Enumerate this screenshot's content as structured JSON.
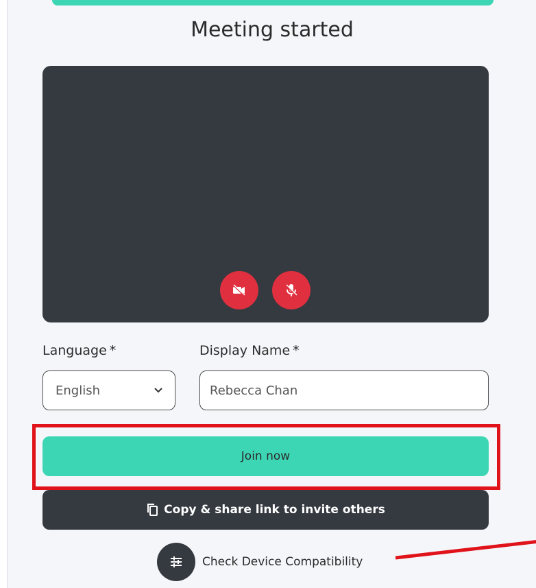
{
  "page": {
    "title": "Meeting started"
  },
  "video": {
    "camera_button_icon": "camera-off-icon",
    "mic_button_icon": "mic-off-icon",
    "button_color": "#e0303f"
  },
  "form": {
    "language_label": "Language",
    "display_name_label": "Display Name",
    "required_mark": "*",
    "language_value": "English",
    "display_name_value": "Rebecca Chan"
  },
  "actions": {
    "join_label": "Join now",
    "copy_label": "Copy & share link to invite others",
    "compat_label": "Check Device Compatibility"
  },
  "colors": {
    "accent": "#3dd6b5",
    "dark": "#353940",
    "annotation_red": "#e0131b"
  }
}
